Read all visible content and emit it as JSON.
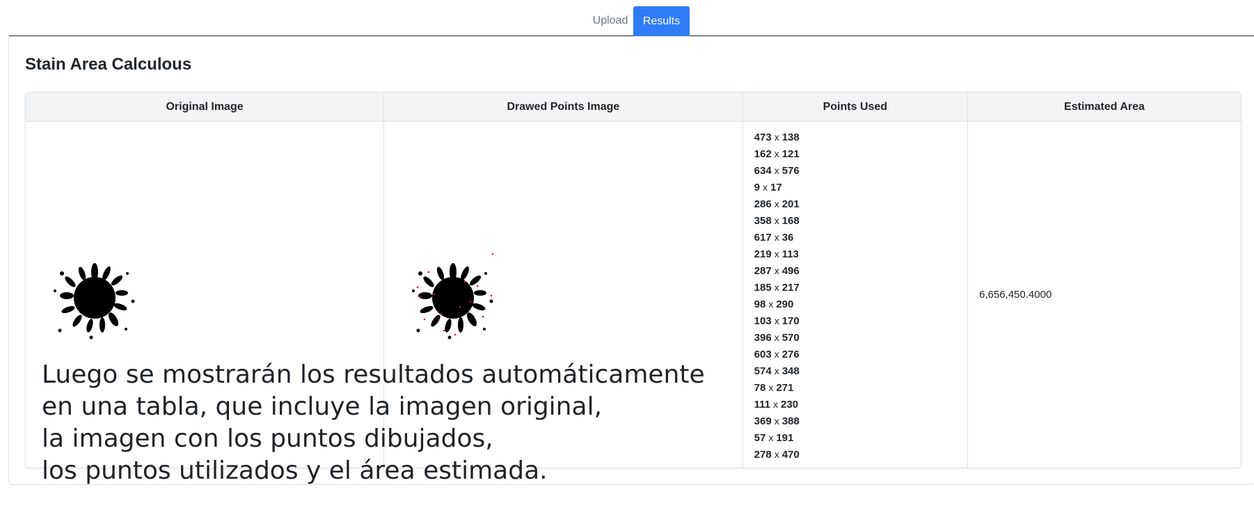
{
  "tabs": [
    {
      "label": "Upload",
      "active": false
    },
    {
      "label": "Results",
      "active": true
    }
  ],
  "colors": {
    "accent": "#2f7cf6",
    "header_bg": "#f3f4f6",
    "border": "#dee2e6",
    "point_marker": "#e0141e"
  },
  "page_title": "Stain Area Calculous",
  "table": {
    "headers": [
      "Original Image",
      "Drawed Points Image",
      "Points Used",
      "Estimated Area"
    ],
    "points_separator": "x",
    "points": [
      {
        "x": "473",
        "y": "138"
      },
      {
        "x": "162",
        "y": "121"
      },
      {
        "x": "634",
        "y": "576"
      },
      {
        "x": "9",
        "y": "17"
      },
      {
        "x": "286",
        "y": "201"
      },
      {
        "x": "358",
        "y": "168"
      },
      {
        "x": "617",
        "y": "36"
      },
      {
        "x": "219",
        "y": "113"
      },
      {
        "x": "287",
        "y": "496"
      },
      {
        "x": "185",
        "y": "217"
      },
      {
        "x": "98",
        "y": "290"
      },
      {
        "x": "103",
        "y": "170"
      },
      {
        "x": "396",
        "y": "570"
      },
      {
        "x": "603",
        "y": "276"
      },
      {
        "x": "574",
        "y": "348"
      },
      {
        "x": "78",
        "y": "271"
      },
      {
        "x": "111",
        "y": "230"
      },
      {
        "x": "369",
        "y": "388"
      },
      {
        "x": "57",
        "y": "191"
      },
      {
        "x": "278",
        "y": "470"
      }
    ],
    "estimated_area": "6,656,450.4000"
  },
  "caption": [
    "Luego se mostrarán los resultados automáticamente",
    "en una tabla, que incluye la imagen original,",
    "la imagen con los puntos dibujados,",
    "los puntos utilizados y el área estimada."
  ]
}
